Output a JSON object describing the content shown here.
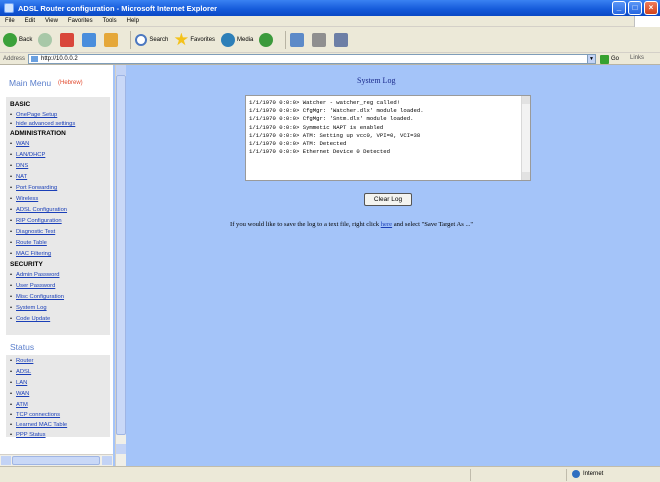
{
  "window": {
    "title": "ADSL Router configuration - Microsoft Internet Explorer",
    "buttons": {
      "minimize": "_",
      "maximize": "□",
      "close": "×"
    }
  },
  "menubar": [
    "File",
    "Edit",
    "View",
    "Favorites",
    "Tools",
    "Help"
  ],
  "toolbar": {
    "back": "Back",
    "search": "Search",
    "favorites": "Favorites",
    "media": "Media"
  },
  "addressbar": {
    "label": "Address",
    "url": "http://10.0.0.2",
    "go": "Go",
    "links": "Links"
  },
  "sidebar": {
    "menu_title": "Main Menu",
    "language": "(Hebrew)",
    "basic": {
      "heading": "BASIC",
      "items": [
        "OnePage Setup",
        "hide advanced settings"
      ]
    },
    "administration": {
      "heading": "ADMINISTRATION",
      "items": [
        "WAN",
        "LAN/DHCP",
        "DNS",
        "NAT",
        "Port Forwarding",
        "Wireless",
        "ADSL Configuration",
        "RIP Configuration",
        "Diagnostic Test",
        "Route Table",
        "MAC Filtering"
      ]
    },
    "security": {
      "heading": "SECURITY",
      "items": [
        "Admin Password",
        "User Password",
        "Misc Configuration",
        "System Log",
        "Code Update"
      ]
    },
    "status": {
      "heading": "Status",
      "items": [
        "Router",
        "ADSL",
        "LAN",
        "WAN",
        "ATM",
        "TCP connections",
        "Learned MAC Table",
        "PPP Status"
      ]
    }
  },
  "main": {
    "title": "System Log",
    "log_lines": [
      "1/1/1970 0:0:0> Watcher - watcher_reg called!",
      "1/1/1970 0:0:0> CfgMgr: 'Watcher.dlx' module loaded.",
      "1/1/1970 0:0:0> CfgMgr: 'Sntm.dlx' module loaded.",
      "1/1/1970 0:0:0> Symmetic NAPT is enabled",
      "1/1/1970 0:0:0> ATM: Setting up vcc0, VPI=0, VCI=38",
      "1/1/1970 0:0:0> ATM: Detected",
      "1/1/1970 0:0:0> Ethernet Device 0 Detected"
    ],
    "clear_button": "Clear Log",
    "hint_before": "If you would like to save the log to a text file, right click ",
    "hint_link": "here",
    "hint_after": " and select \"Save Target As ...\""
  },
  "statusbar": {
    "zone": "Internet"
  }
}
